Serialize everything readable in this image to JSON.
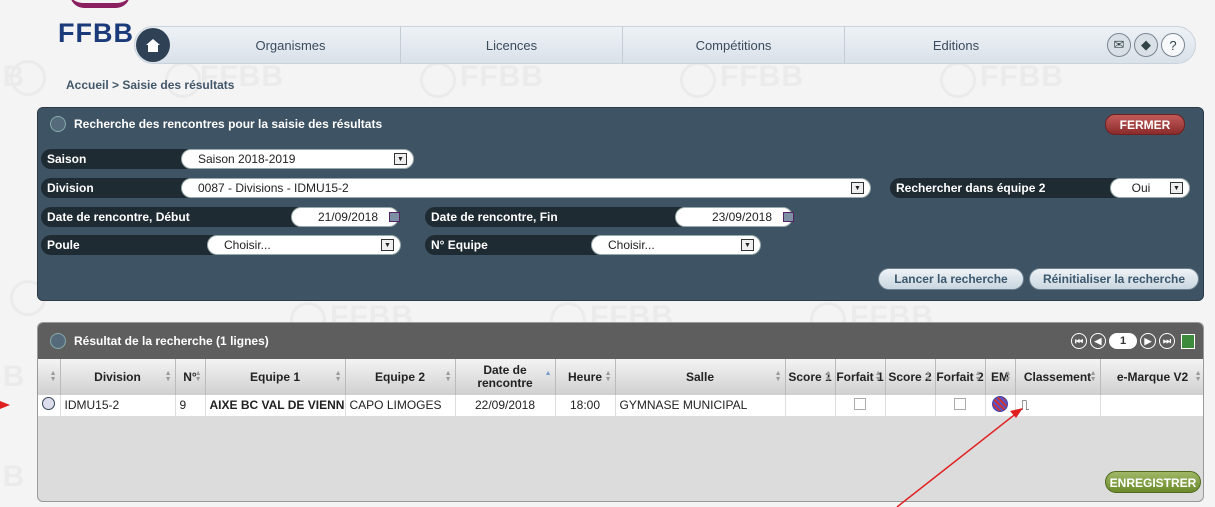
{
  "logo": "FFBB",
  "nav": {
    "items": [
      "Organismes",
      "Licences",
      "Compétitions",
      "Editions"
    ],
    "icons": [
      "home-icon",
      "mail-icon",
      "book-icon",
      "help-icon"
    ],
    "help_label": "?"
  },
  "breadcrumb": "Accueil > Saisie des résultats",
  "search": {
    "title": "Recherche des rencontres pour la saisie des résultats",
    "close_label": "FERMER",
    "saison_label": "Saison",
    "saison_value": "Saison 2018-2019",
    "division_label": "Division",
    "division_value": "0087 - Divisions - IDMU15-2",
    "equipe2_label": "Rechercher dans équipe 2",
    "equipe2_value": "Oui",
    "date_debut_label": "Date de rencontre, Début",
    "date_debut_value": "21/09/2018",
    "date_fin_label": "Date de rencontre, Fin",
    "date_fin_value": "23/09/2018",
    "poule_label": "Poule",
    "poule_value": "Choisir...",
    "num_equipe_label": "N° Equipe",
    "num_equipe_value": "Choisir...",
    "search_button": "Lancer la recherche",
    "reset_button": "Réinitialiser la recherche"
  },
  "results": {
    "title": "Résultat de la recherche (1 lignes)",
    "current_page": "1",
    "columns": [
      "Division",
      "N°",
      "Equipe 1",
      "Equipe 2",
      "Date de rencontre",
      "Heure",
      "Salle",
      "Score 1",
      "Forfait 1",
      "Score 2",
      "Forfait 2",
      "EM",
      "Classement",
      "e-Marque V2"
    ],
    "rows": [
      {
        "division": "IDMU15-2",
        "num": "9",
        "equipe1": "AIXE BC VAL DE VIENNE",
        "equipe2": "CAPO LIMOGES",
        "date": "22/09/2018",
        "heure": "18:00",
        "salle": "GYMNASE MUNICIPAL",
        "score1": "",
        "score2": ""
      }
    ],
    "save_button": "ENREGISTRER"
  },
  "colors": {
    "panel": "#3e5364",
    "annotation_arrow": "#e02020",
    "save": "#7a9a3a",
    "close": "#a33a3a"
  }
}
